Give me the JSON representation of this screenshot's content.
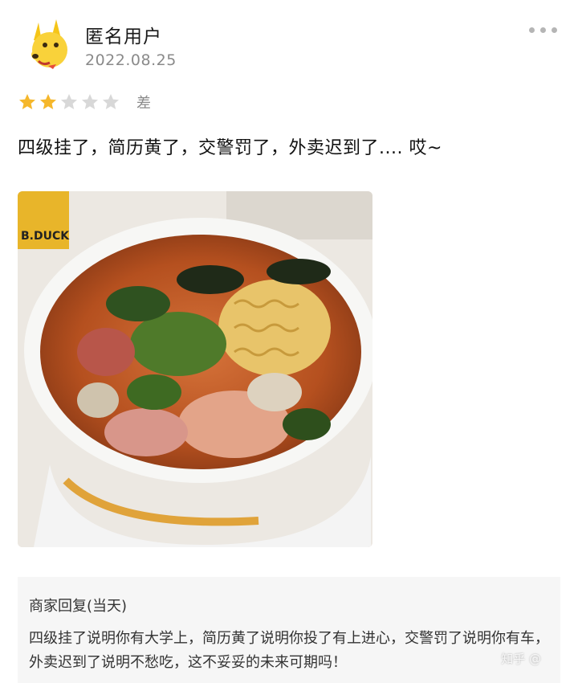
{
  "user": {
    "name": "匿名用户",
    "date": "2022.08.25"
  },
  "rating": {
    "value": 2,
    "max": 5,
    "label": "差",
    "filled_color": "#f5b72b",
    "empty_color": "#d8d8d8"
  },
  "review": {
    "text": "四级挂了，简历黄了，交警罚了，外卖迟到了.... 哎~"
  },
  "photo": {
    "cup_logo_text": "B.DUCK"
  },
  "reply": {
    "title": "商家回复(当天)",
    "text": "四级挂了说明你有大学上，简历黄了说明你投了有上进心，交警罚了说明你有车，外卖迟到了说明不愁吃，这不妥妥的未来可期吗！"
  },
  "watermark": {
    "text": "知乎 @"
  }
}
